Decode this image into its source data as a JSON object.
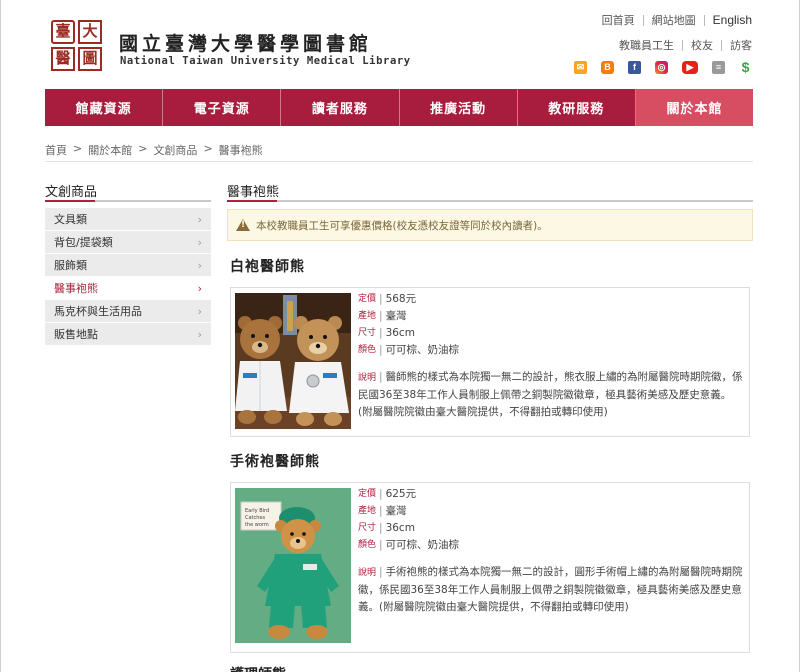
{
  "header": {
    "logo_chars": [
      "臺",
      "大",
      "醫",
      "圖"
    ],
    "title_cn": "國立臺灣大學醫學圖書館",
    "title_en": "National Taiwan University Medical Library",
    "top_links": [
      "回首頁",
      "網站地圖",
      "English"
    ],
    "sub_links": [
      "教職員工生",
      "校友",
      "訪客"
    ],
    "social_icons": [
      "mail-icon",
      "blog-icon",
      "facebook-icon",
      "instagram-icon",
      "youtube-icon",
      "news-icon",
      "donate-icon"
    ]
  },
  "nav": {
    "items": [
      "館藏資源",
      "電子資源",
      "讀者服務",
      "推廣活動",
      "教研服務",
      "關於本館"
    ],
    "colors": {
      "bar": "#a81c3e",
      "active": "#d74d62"
    }
  },
  "breadcrumb": [
    "首頁",
    "關於本館",
    "文創商品",
    "醫事袍熊"
  ],
  "sidebar": {
    "title": "文創商品",
    "items": [
      {
        "label": "文具類"
      },
      {
        "label": "背包/提袋類"
      },
      {
        "label": "服飾類"
      },
      {
        "label": "醫事袍熊",
        "active": true
      },
      {
        "label": "馬克杯與生活用品"
      },
      {
        "label": "販售地點"
      }
    ]
  },
  "main": {
    "title": "醫事袍熊",
    "notice": "本校教職員工生可享優惠價格(校友憑校友證等同於校內讀者)。",
    "labels": {
      "price": "定價",
      "origin": "產地",
      "size": "尺寸",
      "color": "顏色",
      "desc": "說明"
    },
    "products": [
      {
        "name": "白袍醫師熊",
        "price": "568元",
        "origin": "臺灣",
        "size": "36cm",
        "color": "可可棕、奶油棕",
        "desc": "醫師熊的樣式為本院獨一無二的設計，熊衣服上繡的為附屬醫院時期院徽，係民國36至38年工作人員制服上佩帶之銅製院徽徽章，極具藝術美感及歷史意義。(附屬醫院院徽由臺大醫院提供，不得翻拍或轉印使用)"
      },
      {
        "name": "手術袍醫師熊",
        "price": "625元",
        "origin": "臺灣",
        "size": "36cm",
        "color": "可可棕、奶油棕",
        "desc": "手術袍熊的樣式為本院獨一無二的設計，圓形手術帽上繡的為附屬醫院時期院徽，係民國36至38年工作人員制服上佩帶之銅製院徽徽章，極具藝術美感及歷史意義。(附屬醫院院徽由臺大醫院提供，不得翻拍或轉印使用)"
      }
    ],
    "next_product_partial": "護理師熊"
  }
}
